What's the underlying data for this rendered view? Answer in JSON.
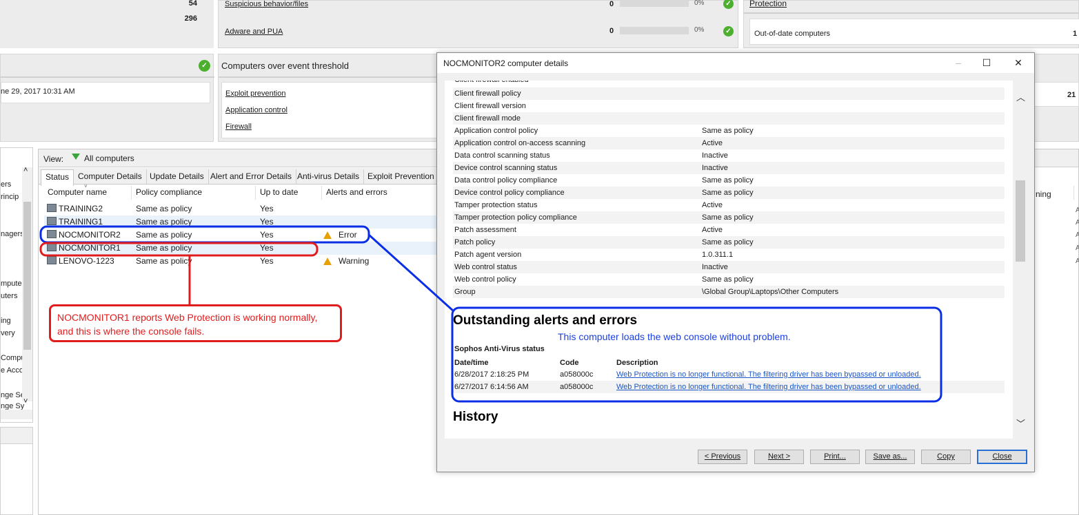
{
  "top": {
    "left_counts": [
      "54",
      "296"
    ],
    "threats": [
      {
        "label": "Suspicious behavior/files",
        "count": "0",
        "pct": "0%"
      },
      {
        "label": "Adware and PUA",
        "count": "0",
        "pct": "0%"
      }
    ],
    "protection": {
      "title": "Protection",
      "row_label": "Out-of-date computers",
      "row_value": "1"
    },
    "date_text": "ne 29, 2017 10:31 AM",
    "threshold": {
      "title": "Computers over event threshold",
      "links": [
        "Exploit prevention",
        "Application control",
        "Firewall"
      ]
    },
    "right_value": "21"
  },
  "sidebar": {
    "items": [
      "ers",
      "rincip",
      "nagers",
      "mpute",
      "uters",
      "ing",
      "very",
      "Compu",
      "e Acco",
      "nge Se",
      "nge Sy"
    ]
  },
  "view": {
    "label": "View:",
    "filter": "All computers"
  },
  "tabs": [
    "Status",
    "Computer Details",
    "Update Details",
    "Alert and Error Details",
    "Anti-virus Details",
    "Exploit Prevention"
  ],
  "table": {
    "columns": [
      "Computer name",
      "Policy compliance",
      "Up to date",
      "Alerts and errors"
    ],
    "partial_right_header": "ning",
    "rows": [
      {
        "name": "TRAINING2",
        "policy": "Same as policy",
        "uptodate": "Yes",
        "alert": "",
        "alert_icon": ""
      },
      {
        "name": "TRAINING1",
        "policy": "Same as policy",
        "uptodate": "Yes",
        "alert": "",
        "alert_icon": ""
      },
      {
        "name": "NOCMONITOR2",
        "policy": "Same as policy",
        "uptodate": "Yes",
        "alert": "Error",
        "alert_icon": "warning-icon"
      },
      {
        "name": "NOCMONITOR1",
        "policy": "Same as policy",
        "uptodate": "Yes",
        "alert": "",
        "alert_icon": ""
      },
      {
        "name": "LENOVO-1223",
        "policy": "Same as policy",
        "uptodate": "Yes",
        "alert": "Warning",
        "alert_icon": "warning-icon"
      }
    ]
  },
  "callout": {
    "line1": "NOCMONITOR1 reports Web Protection is working normally,",
    "line2": "and this is where the console fails.",
    "color": "#e11c1c"
  },
  "dialog": {
    "title": "NOCMONITOR2 computer details",
    "cut_row": "Client firewall enabled",
    "details": [
      {
        "k": "Client firewall policy",
        "v": ""
      },
      {
        "k": "Client firewall version",
        "v": ""
      },
      {
        "k": "Client firewall mode",
        "v": ""
      },
      {
        "k": "Application control policy",
        "v": "Same as policy"
      },
      {
        "k": "Application control on-access scanning",
        "v": "Active"
      },
      {
        "k": "Data control scanning status",
        "v": "Inactive"
      },
      {
        "k": "Device control scanning status",
        "v": "Inactive"
      },
      {
        "k": "Data control policy compliance",
        "v": "Same as policy"
      },
      {
        "k": "Device control policy compliance",
        "v": "Same as policy"
      },
      {
        "k": "Tamper protection status",
        "v": "Active"
      },
      {
        "k": "Tamper protection policy compliance",
        "v": "Same as policy"
      },
      {
        "k": "Patch assessment",
        "v": "Active"
      },
      {
        "k": "Patch policy",
        "v": "Same as policy"
      },
      {
        "k": "Patch agent version",
        "v": "1.0.311.1"
      },
      {
        "k": "Web control status",
        "v": "Inactive"
      },
      {
        "k": "Web control policy",
        "v": "Same as policy"
      },
      {
        "k": "Group",
        "v": "\\Global Group\\Laptops\\Other Computers"
      }
    ],
    "alerts_heading": "Outstanding alerts and errors",
    "annotation": "This computer loads the web console without problem.",
    "annotation_color": "#1a3fe0",
    "av_heading": "Sophos Anti-Virus status",
    "alert_cols": [
      "Date/time",
      "Code",
      "Description"
    ],
    "alerts": [
      {
        "date": "6/28/2017 2:18:25 PM",
        "code": "a058000c",
        "desc": "Web Protection is no longer functional. The filtering driver has been bypassed or unloaded."
      },
      {
        "date": "6/27/2017 6:14:56 AM",
        "code": "a058000c",
        "desc": "Web Protection is no longer functional. The filtering driver has been bypassed or unloaded."
      }
    ],
    "history_heading": "History",
    "buttons": {
      "prev": "< Previous",
      "next": "Next >",
      "print": "Print...",
      "save": "Save as...",
      "copy": "Copy",
      "close": "Close"
    }
  },
  "colors": {
    "highlight_blue": "#0a2ee6",
    "highlight_red": "#e11c1c",
    "ok_green": "#4caf2e"
  }
}
